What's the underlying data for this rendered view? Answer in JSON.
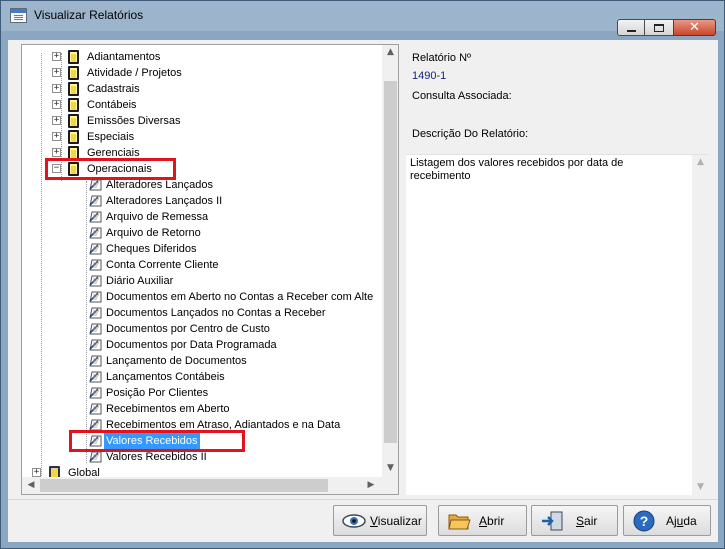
{
  "window": {
    "title": "Visualizar Relatórios"
  },
  "tree": {
    "top_nodes": [
      "Adiantamentos",
      "Atividade / Projetos",
      "Cadastrais",
      "Contábeis",
      "Emissões Diversas",
      "Especiais",
      "Gerenciais"
    ],
    "expanded_node": "Operacionais",
    "expanded_children": [
      "Alteradores  Lançados",
      "Alteradores  Lançados II",
      "Arquivo de Remessa",
      "Arquivo de Retorno",
      "Cheques Diferidos",
      "Conta Corrente Cliente",
      "Diário  Auxiliar",
      "Documentos em Aberto no Contas a Receber com Alte",
      "Documentos Lançados no Contas a Receber",
      "Documentos por Centro de Custo",
      "Documentos por Data Programada",
      "Lançamento  de Documentos",
      "Lançamentos Contábeis",
      "Posição Por Clientes",
      "Recebimentos em Aberto",
      "Recebimentos em Atraso, Adiantados e na Data",
      "Valores Recebidos",
      "Valores Recebidos II"
    ],
    "selected_node": "Valores Recebidos",
    "last_root": "Global"
  },
  "details": {
    "report_number_label": "Relatório Nº",
    "report_number_value": "1490-1",
    "consulta_label": "Consulta Associada:",
    "descricao_label": "Descrição Do Relatório:",
    "descricao_text": "Listagem dos valores recebidos por data de recebimento"
  },
  "buttons": {
    "visualizar": {
      "label_u": "V",
      "label_rest": "isualizar",
      "icon": "eye-icon"
    },
    "abrir": {
      "label_u": "A",
      "label_rest": "brir",
      "icon": "folder-open-icon"
    },
    "sair": {
      "label_u": "S",
      "label_rest": "air",
      "icon": "exit-icon"
    },
    "ajuda": {
      "label_rest_pre": "Aj",
      "label_u": "u",
      "label_rest": "da",
      "icon": "help-icon"
    }
  },
  "colors": {
    "selection": "#3399ff",
    "highlight_box": "#e0141e",
    "report_number": "#1a237e"
  }
}
